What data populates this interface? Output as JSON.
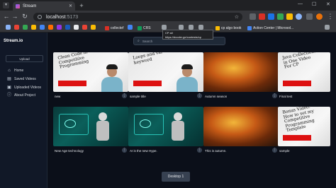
{
  "browser": {
    "tab_title": "Stream",
    "tab_close": "✕",
    "new_tab": "+",
    "minimize": "—",
    "maximize": "☐",
    "close": "✕",
    "url_host": "localhost",
    "url_port": ":5173",
    "bookmarks": [
      "collectef",
      "CRS",
      "cp algo book",
      "Action Center | Microsol..."
    ],
    "tooltip_title": "CP all",
    "tooltip_url": "https://dcoder.ge/contests/cp"
  },
  "app": {
    "brand": "Stream.io",
    "upload_label": "Upload",
    "search_placeholder": "Search",
    "nav": [
      {
        "label": "Home",
        "icon": "home-icon"
      },
      {
        "label": "Saved Videos",
        "icon": "saved-icon"
      },
      {
        "label": "Uploaded Videos",
        "icon": "uploaded-icon"
      },
      {
        "label": "About Project",
        "icon": "info-icon"
      }
    ],
    "videos": [
      {
        "title": "new",
        "thumb": "code",
        "overlay": "Clean Code in Competitive Programming"
      },
      {
        "title": "sample title",
        "thumb": "code",
        "overlay": "Loops and var keyword"
      },
      {
        "title": "Autumn season",
        "thumb": "autumn",
        "overlay": ""
      },
      {
        "title": "Final test",
        "thumb": "code",
        "overlay": "Java Collections in One Video For CP"
      },
      {
        "title": "New Age technology",
        "thumb": "ai",
        "overlay": ""
      },
      {
        "title": "AI is the new Hype.",
        "thumb": "ai",
        "overlay": ""
      },
      {
        "title": "This is autumn.",
        "thumb": "autumn",
        "overlay": ""
      },
      {
        "title": "sample",
        "thumb": "code",
        "overlay": "Bonus Video: How to set my Competitive Programming Template"
      }
    ],
    "pager_label": "Desktop 1",
    "card_menu": "⋮"
  }
}
